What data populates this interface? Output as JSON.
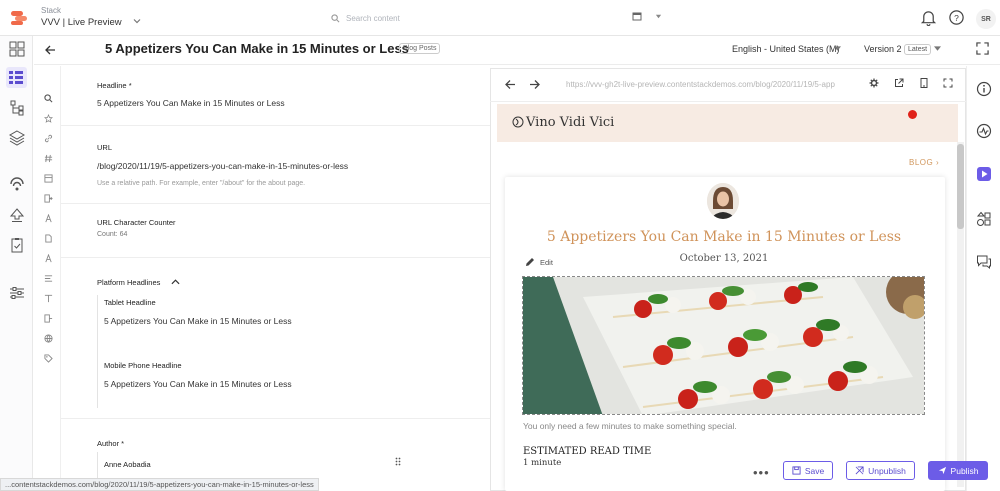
{
  "topbar": {
    "stack_label": "Stack",
    "stack_name": "VVV | Live Preview",
    "search_placeholder": "Search content",
    "avatar_initials": "SR"
  },
  "header": {
    "entry_title": "5 Appetizers You Can Make in 15 Minutes or Less",
    "content_type": "Blog Posts",
    "locale": "English - United States (M)",
    "version": "Version 2",
    "version_badge": "Latest"
  },
  "form": {
    "headline_label": "Headline *",
    "headline_value": "5 Appetizers You Can Make in 15 Minutes or Less",
    "url_label": "URL",
    "url_value": "/blog/2020/11/19/5-appetizers-you-can-make-in-15-minutes-or-less",
    "url_help": "Use a relative path. For example, enter \"/about\" for the about page.",
    "counter_label": "URL Character Counter",
    "counter_value": "Count: 64",
    "platform_label": "Platform Headlines",
    "tablet_label": "Tablet Headline",
    "tablet_value": "5 Appetizers You Can Make in 15 Minutes or Less",
    "mobile_label": "Mobile Phone Headline",
    "mobile_value": "5 Appetizers You Can Make in 15 Minutes or Less",
    "author_label": "Author *",
    "author_value": "Anne Aobadia"
  },
  "preview": {
    "url": "https://vvv-gh2t-live-preview.contentstackdemos.com/blog/2020/11/19/5-app",
    "brand": "Vino Vidi Vici",
    "blog_link": "BLOG ›",
    "post_title": "5 Appetizers You Can Make in 15 Minutes or Less",
    "edit_label": "Edit",
    "post_date": "October 13, 2021",
    "caption": "You only need a few minutes to make something special.",
    "read_time_label": "ESTIMATED READ TIME",
    "read_time": "1 minute"
  },
  "actions": {
    "more": "•••",
    "save": "Save",
    "unpublish": "Unpublish",
    "publish": "Publish"
  },
  "status_url": "...contentstackdemos.com/blog/2020/11/19/5-appetizers-you-can-make-in-15-minutes-or-less",
  "colors": {
    "accent": "#6c5ce7",
    "brand_orange": "#d0935a",
    "site_header": "#f7ebe3",
    "record_dot": "#e0221a"
  }
}
